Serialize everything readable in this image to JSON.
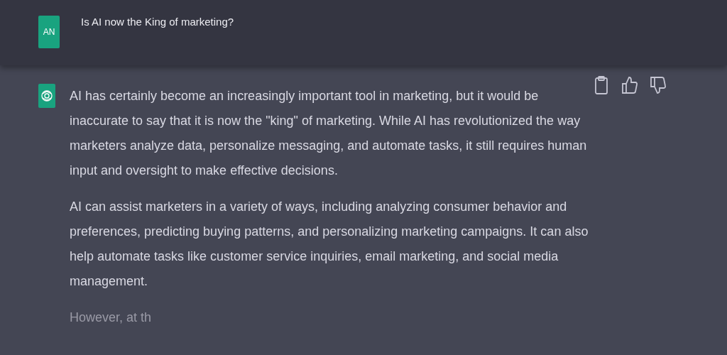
{
  "user_message": {
    "avatar": "AN",
    "text": "Is AI now the King of marketing?"
  },
  "assistant_message": {
    "paragraphs": [
      "AI has certainly become an increasingly important tool in marketing, but it would be inaccurate to say that it is now the \"king\" of marketing. While AI has revolutionized the way marketers analyze data, personalize messaging, and automate tasks, it still requires human input and oversight to make effective decisions.",
      "AI can assist marketers in a variety of ways, including analyzing consumer behavior and preferences, predicting buying patterns, and personalizing marketing campaigns. It can also help automate tasks like customer service inquiries, email marketing, and social media management.",
      "However, at th"
    ]
  }
}
